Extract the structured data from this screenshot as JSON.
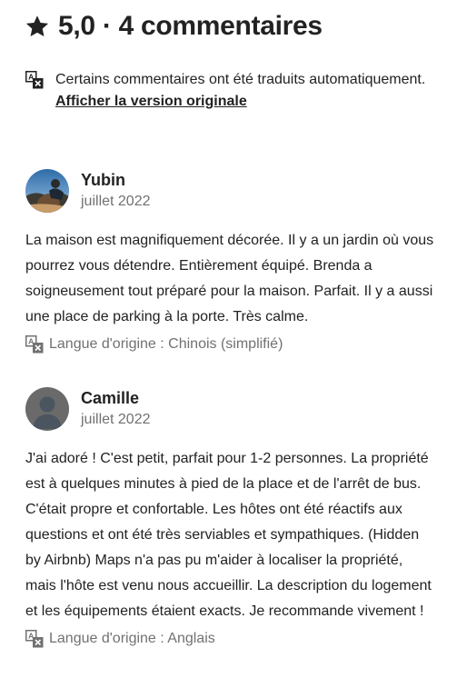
{
  "header": {
    "title": "5,0 · 4 commentaires"
  },
  "notice": {
    "text": "Certains commentaires ont été traduits automatiquement. ",
    "link": "Afficher la version originale"
  },
  "reviews": [
    {
      "name": "Yubin",
      "date": "juillet 2022",
      "text": "La maison est magnifiquement décorée. Il y a un jardin où vous pourrez vous détendre. Entièrement équipé. Brenda a soigneusement tout préparé pour la maison. Parfait. Il y a aussi une place de parking à la porte. Très calme.",
      "origin": "Langue d'origine : Chinois (simplifié)"
    },
    {
      "name": "Camille",
      "date": "juillet 2022",
      "text": "J'ai adoré ! C'est petit, parfait pour 1-2 personnes. La propriété est à quelques minutes à pied de la place et de l'arrêt de bus. C'était propre et confortable. Les hôtes ont été réactifs aux questions et ont été très serviables et sympathiques. (Hidden by Airbnb) Maps n'a pas pu m'aider à localiser la propriété, mais l'hôte est venu nous accueillir. La description du logement et les équipements étaient exacts. Je recommande vivement !",
      "origin": "Langue d'origine : Anglais"
    }
  ],
  "colors": {
    "text": "#222222",
    "secondary": "#717171"
  }
}
